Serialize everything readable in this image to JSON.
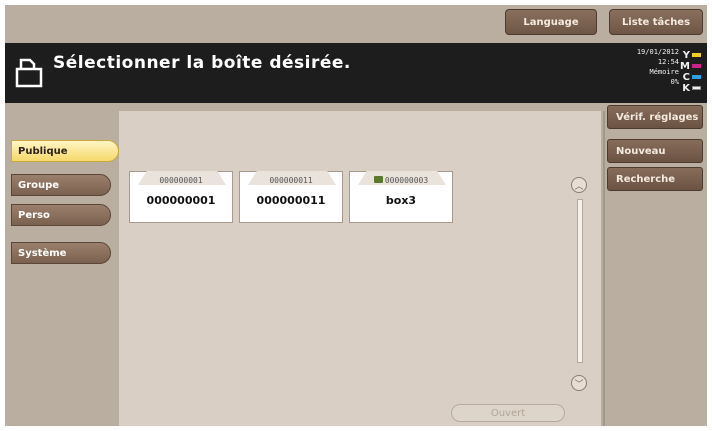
{
  "top_buttons": {
    "language": "Language",
    "job_list": "Liste tâches"
  },
  "header": {
    "icon": "user-box-icon",
    "title": "Sélectionner la boîte désirée."
  },
  "status": {
    "date": "19/01/2012",
    "time": "12:54",
    "memory_label": "Mémoire",
    "memory_value": "0%",
    "ink": [
      {
        "letter": "Y",
        "color": "#f0d020"
      },
      {
        "letter": "M",
        "color": "#d0208a"
      },
      {
        "letter": "C",
        "color": "#2aa0e0"
      },
      {
        "letter": "K",
        "color": "#202020"
      }
    ]
  },
  "side_buttons": {
    "check_settings": "Vérif. réglages",
    "new": "Nouveau",
    "search": "Recherche"
  },
  "tabs": [
    {
      "label": "Publique",
      "active": true
    },
    {
      "label": "Groupe",
      "active": false
    },
    {
      "label": "Perso",
      "active": false
    },
    {
      "label": "Système",
      "active": false
    }
  ],
  "boxes": [
    {
      "number": "000000001",
      "name": "000000001",
      "locked": false
    },
    {
      "number": "000000011",
      "name": "000000011",
      "locked": false
    },
    {
      "number": "000000003",
      "name": "box3",
      "locked": true
    }
  ],
  "open_button": "Ouvert"
}
